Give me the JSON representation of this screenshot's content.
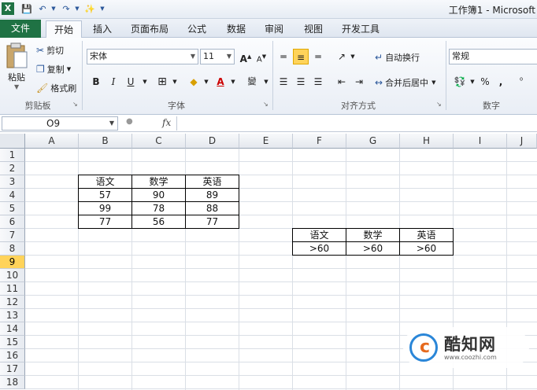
{
  "titlebar": {
    "logo": "X",
    "title": "工作簿1 - Microsoft",
    "qa_icons": [
      "save-icon",
      "undo-icon",
      "redo-icon",
      "customize-icon"
    ]
  },
  "tabs": {
    "file": "文件",
    "items": [
      "开始",
      "插入",
      "页面布局",
      "公式",
      "数据",
      "审阅",
      "视图",
      "开发工具"
    ]
  },
  "ribbon": {
    "clipboard": {
      "paste": "粘贴",
      "cut": "剪切",
      "copy": "复制",
      "format_painter": "格式刷",
      "label": "剪贴板"
    },
    "font": {
      "name": "宋体",
      "size": "11",
      "grow": "A",
      "shrink": "A",
      "bold": "B",
      "italic": "I",
      "underline": "U",
      "font_color": "A",
      "phonetic": "變",
      "label": "字体"
    },
    "alignment": {
      "wrap": "自动换行",
      "merge": "合并后居中",
      "label": "对齐方式"
    },
    "number": {
      "format": "常规",
      "percent": "%",
      "comma": ",",
      "label": "数字"
    }
  },
  "formula_bar": {
    "name_box": "O9",
    "fx": "fx",
    "value": ""
  },
  "grid": {
    "columns": [
      "A",
      "B",
      "C",
      "D",
      "E",
      "F",
      "G",
      "H",
      "I",
      "J"
    ],
    "rows": [
      "1",
      "2",
      "3",
      "4",
      "5",
      "6",
      "7",
      "8",
      "9",
      "10",
      "11",
      "12",
      "13",
      "14",
      "15",
      "16",
      "17",
      "18"
    ],
    "active_row": "9"
  },
  "table1": {
    "headers": [
      "语文",
      "数学",
      "英语"
    ],
    "rows": [
      [
        "57",
        "90",
        "89"
      ],
      [
        "99",
        "78",
        "88"
      ],
      [
        "77",
        "56",
        "77"
      ]
    ]
  },
  "table2": {
    "headers": [
      "语文",
      "数学",
      "英语"
    ],
    "rows": [
      [
        ">60",
        ">60",
        ">60"
      ]
    ]
  },
  "watermark": {
    "name": "酷知网",
    "url": "www.coozhi.com"
  }
}
